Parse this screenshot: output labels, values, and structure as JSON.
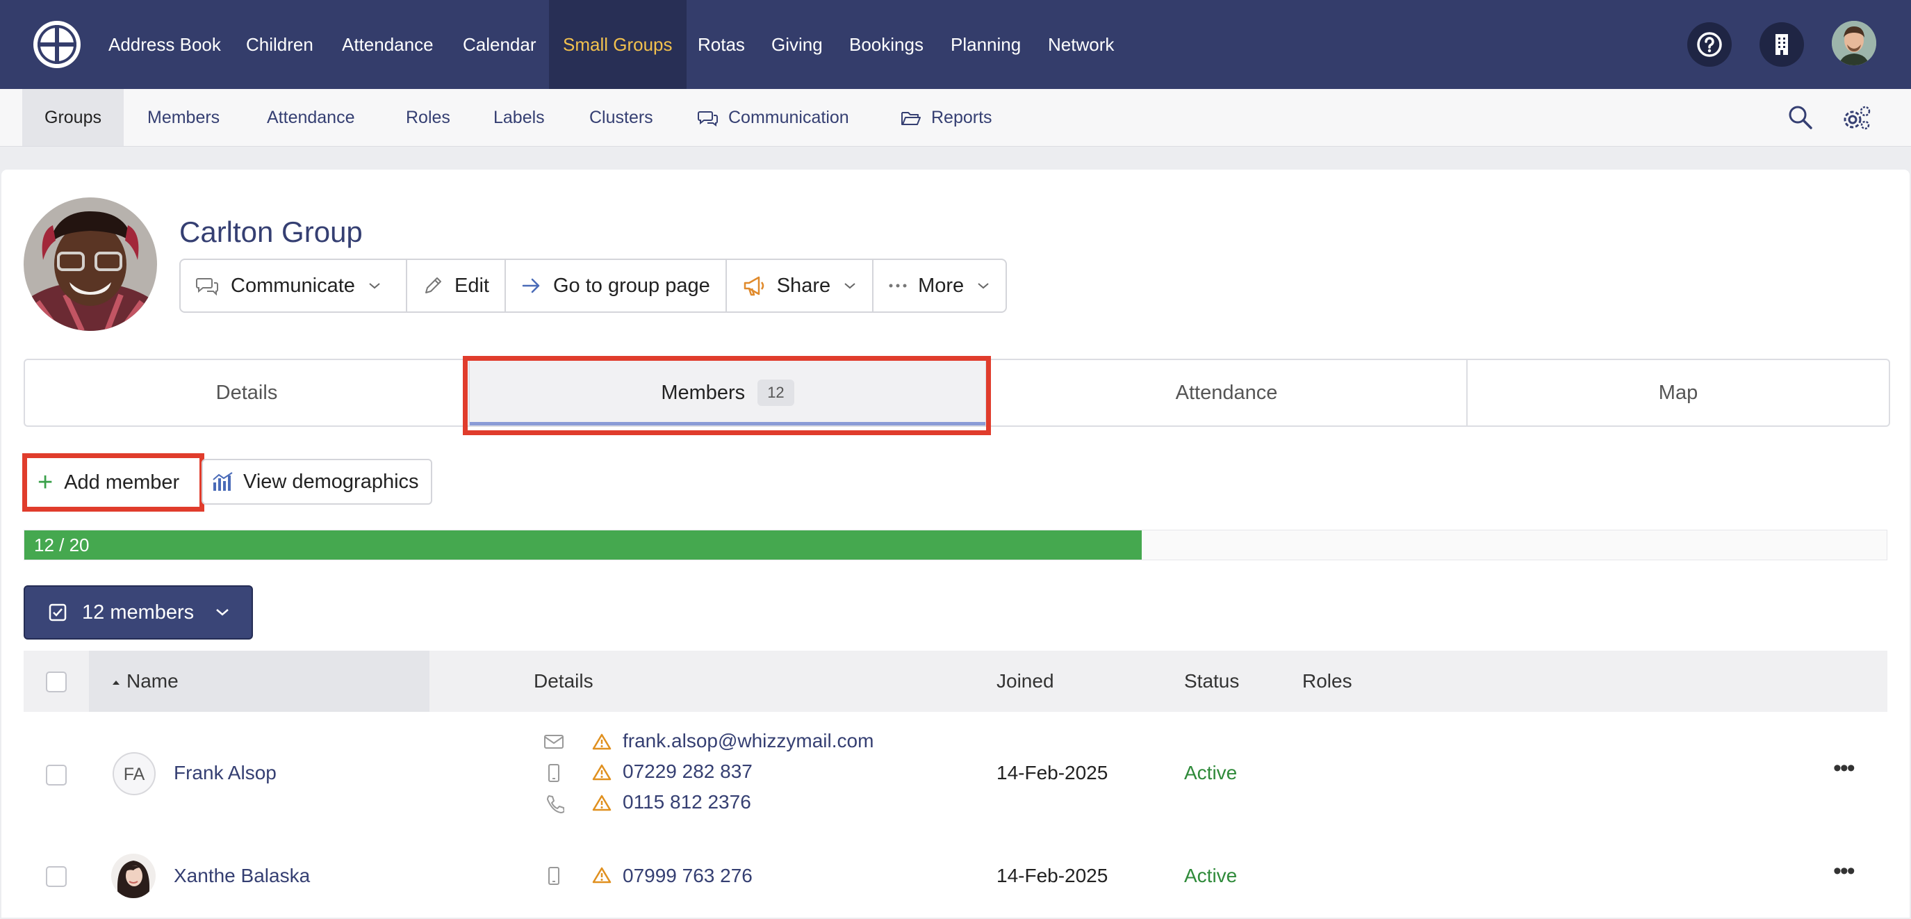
{
  "topnav": {
    "items": [
      "Address Book",
      "Children",
      "Attendance",
      "Calendar",
      "Small Groups",
      "Rotas",
      "Giving",
      "Bookings",
      "Planning",
      "Network"
    ],
    "active": "Small Groups",
    "icons": [
      "help-icon",
      "building-icon"
    ]
  },
  "subnav": {
    "items": [
      "Groups",
      "Members",
      "Attendance",
      "Roles",
      "Labels",
      "Clusters",
      "Communication",
      "Reports"
    ],
    "active": "Groups"
  },
  "group": {
    "title": "Carlton Group",
    "actions": {
      "communicate": "Communicate",
      "edit": "Edit",
      "go_to_page": "Go to group page",
      "share": "Share",
      "more": "More"
    }
  },
  "tabs": {
    "details": "Details",
    "members": "Members",
    "members_count": "12",
    "attendance": "Attendance",
    "map": "Map",
    "active": "Members"
  },
  "member_actions": {
    "add": "Add member",
    "demographics": "View demographics"
  },
  "capacity": {
    "text": "12 / 20",
    "fraction": 0.6
  },
  "selection": {
    "label": "12 members"
  },
  "table": {
    "headers": {
      "name": "Name",
      "details": "Details",
      "joined": "Joined",
      "status": "Status",
      "roles": "Roles"
    },
    "rows": [
      {
        "initials": "FA",
        "name": "Frank Alsop",
        "email": "frank.alsop@whizzymail.com",
        "mobile": "07229 282 837",
        "phone": "0115 812 2376",
        "joined": "14-Feb-2025",
        "status": "Active"
      },
      {
        "name": "Xanthe Balaska",
        "mobile": "07999 763 276",
        "joined": "14-Feb-2025",
        "status": "Active"
      }
    ]
  },
  "colors": {
    "nav_bg": "#343d6b",
    "accent": "#f2c14e",
    "link": "#353f72",
    "progress": "#45a84f",
    "highlight": "#e03c2c",
    "status_active": "#2f8a3a"
  }
}
